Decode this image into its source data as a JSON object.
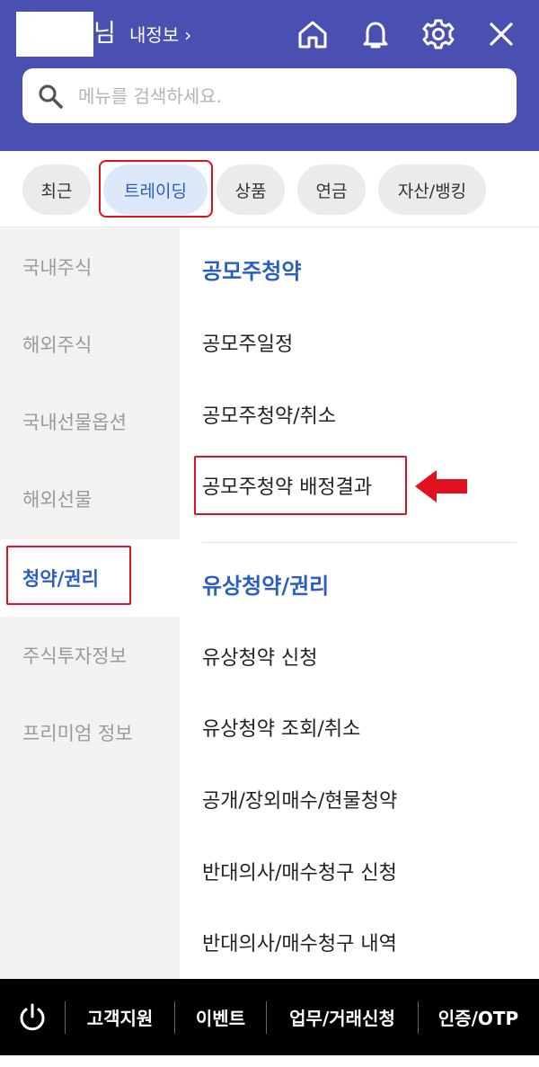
{
  "header": {
    "name_suffix": "님",
    "my_info_label": "내정보",
    "my_info_chevron": "›",
    "icons": [
      "home-icon",
      "bell-icon",
      "gear-icon",
      "close-icon"
    ],
    "background_color": "#4a4fb2"
  },
  "search": {
    "placeholder": "메뉴를 검색하세요."
  },
  "categories": [
    {
      "label": "최근",
      "active": false
    },
    {
      "label": "트레이딩",
      "active": true
    },
    {
      "label": "상품",
      "active": false
    },
    {
      "label": "연금",
      "active": false
    },
    {
      "label": "자산/뱅킹",
      "active": false
    }
  ],
  "left_nav": [
    {
      "label": "국내주식",
      "active": false
    },
    {
      "label": "해외주식",
      "active": false
    },
    {
      "label": "국내선물옵션",
      "active": false
    },
    {
      "label": "해외선물",
      "active": false
    },
    {
      "label": "청약/권리",
      "active": true
    },
    {
      "label": "주식투자정보",
      "active": false
    },
    {
      "label": "프리미엄 정보",
      "active": false
    }
  ],
  "content": {
    "sections": [
      {
        "title": "공모주청약",
        "items": [
          "공모주일정",
          "공모주청약/취소",
          "공모주청약 배정결과"
        ]
      },
      {
        "title": "유상청약/권리",
        "items": [
          "유상청약 신청",
          "유상청약 조회/취소",
          "공개/장외매수/현물청약",
          "반대의사/매수청구 신청",
          "반대의사/매수청구 내역"
        ]
      }
    ]
  },
  "bottom_bar": {
    "power_icon": "power-icon",
    "items": [
      "고객지원",
      "이벤트",
      "업무/거래신청",
      "인증/OTP"
    ]
  },
  "colors": {
    "accent": "#2a5fc1",
    "highlight": "#e0121f",
    "arrow": "#e0121f"
  }
}
